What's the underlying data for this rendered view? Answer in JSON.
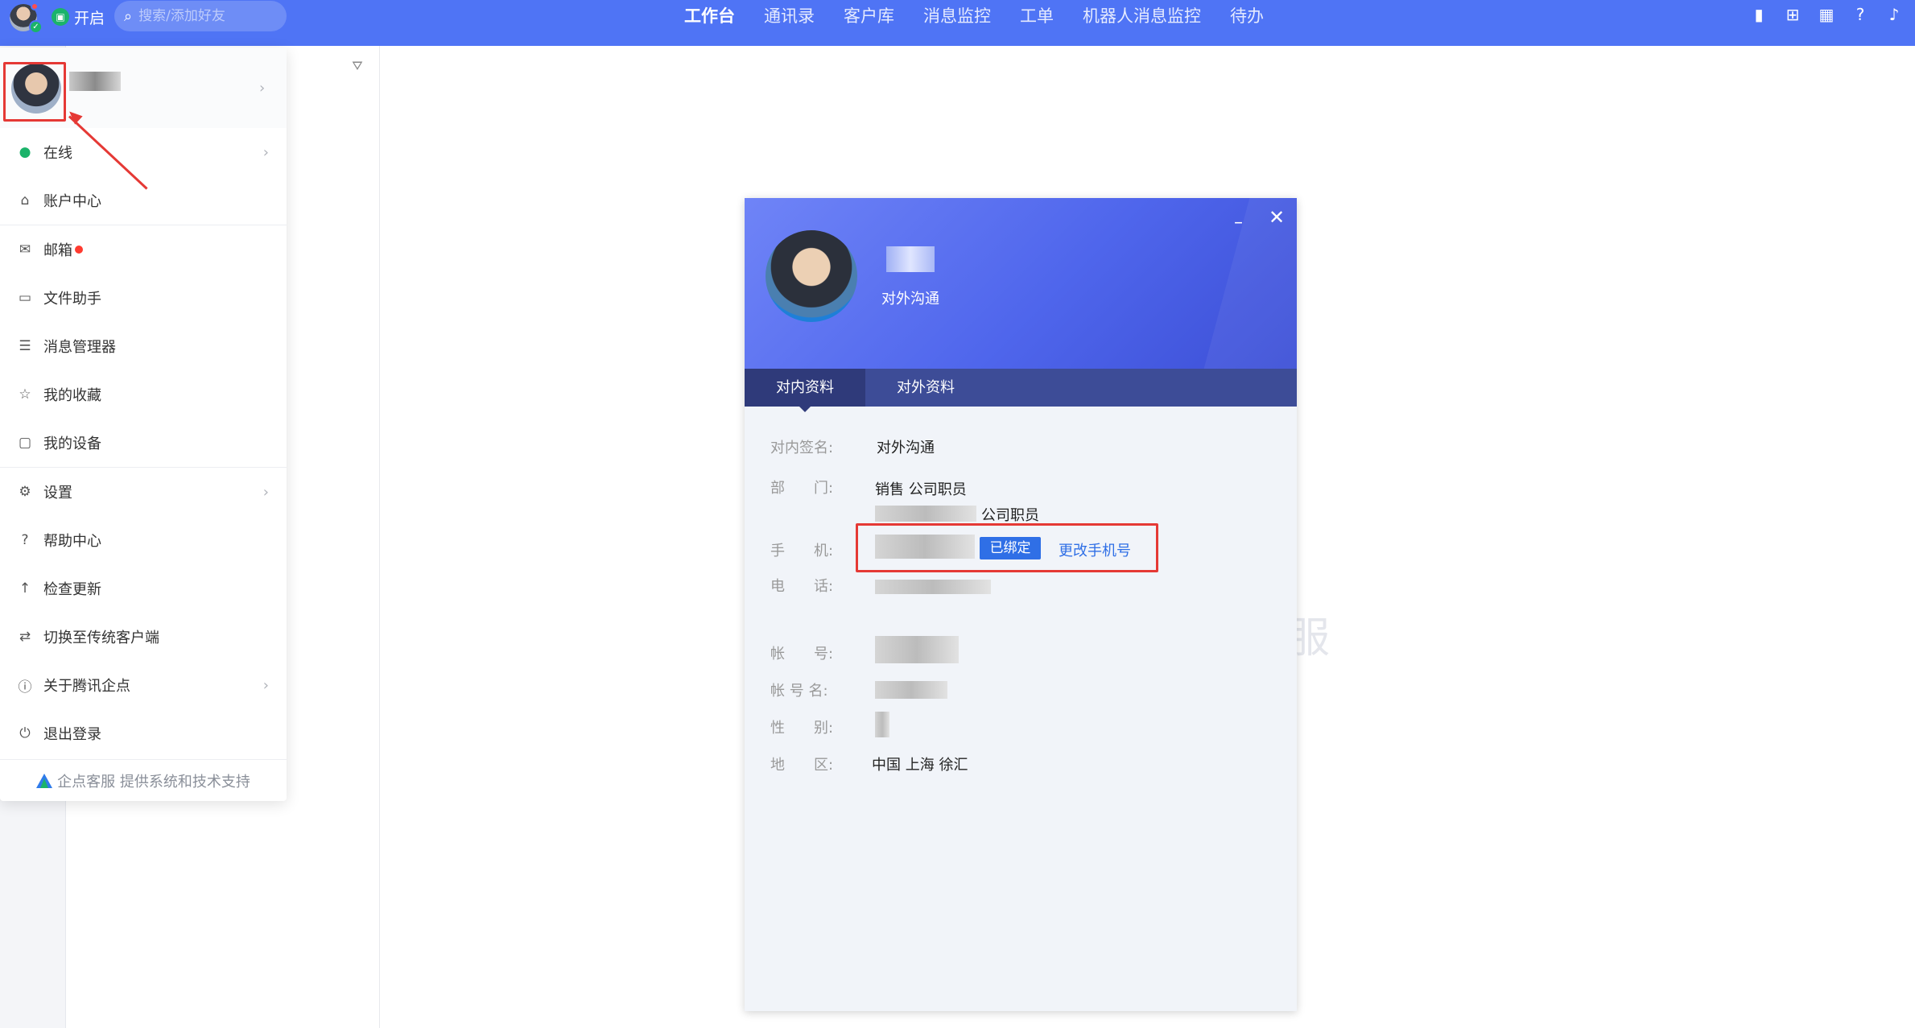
{
  "topbar": {
    "status_label": "开启",
    "search_placeholder": "搜索/添加好友",
    "nav_tabs": [
      "工作台",
      "通讯录",
      "客户库",
      "消息监控",
      "工单",
      "机器人消息监控",
      "待办"
    ],
    "active_tab": "工作台"
  },
  "menu": {
    "items": [
      {
        "label": "在线",
        "icon": "online-check-icon",
        "arrow": true
      },
      {
        "label": "账户中心",
        "icon": "home-icon",
        "arrow": false
      },
      {
        "label": "邮箱",
        "icon": "mail-icon",
        "arrow": false,
        "dot": true
      },
      {
        "label": "文件助手",
        "icon": "folder-icon",
        "arrow": false
      },
      {
        "label": "消息管理器",
        "icon": "message-manager-icon",
        "arrow": false
      },
      {
        "label": "我的收藏",
        "icon": "star-icon",
        "arrow": false
      },
      {
        "label": "我的设备",
        "icon": "monitor-icon",
        "arrow": false
      },
      {
        "label": "设置",
        "icon": "gear-icon",
        "arrow": true
      },
      {
        "label": "帮助中心",
        "icon": "help-icon",
        "arrow": false
      },
      {
        "label": "检查更新",
        "icon": "update-icon",
        "arrow": false
      },
      {
        "label": "切换至传统客户端",
        "icon": "switch-icon",
        "arrow": false
      },
      {
        "label": "关于腾讯企点",
        "icon": "info-icon",
        "arrow": true
      },
      {
        "label": "退出登录",
        "icon": "power-icon",
        "arrow": false
      }
    ],
    "footer": "企点客服 提供系统和技术支持"
  },
  "card": {
    "signature": "对外沟通",
    "tabs": [
      "对内资料",
      "对外资料"
    ],
    "active_tab": "对内资料",
    "fields": {
      "sign_label": "对内签名:",
      "sign_value": "对外沟通",
      "dept_label": "部　　门:",
      "dept_value_1": "销售  公司职员",
      "dept_value_2": "公司职员",
      "phone_label": "手　　机:",
      "phone_badge": "已绑定",
      "phone_change": "更改手机号",
      "tel_label": "电　　话:",
      "account_label": "帐　　号:",
      "account_name_label": "帐 号 名:",
      "gender_label": "性　　别:",
      "region_label": "地　　区:",
      "region_value": "中国 上海 徐汇"
    }
  },
  "watermark": "服",
  "colors": {
    "topbar": "#4f74f5",
    "accent": "#2f6fe6",
    "highlight": "#e53935",
    "online": "#1bb36a"
  }
}
